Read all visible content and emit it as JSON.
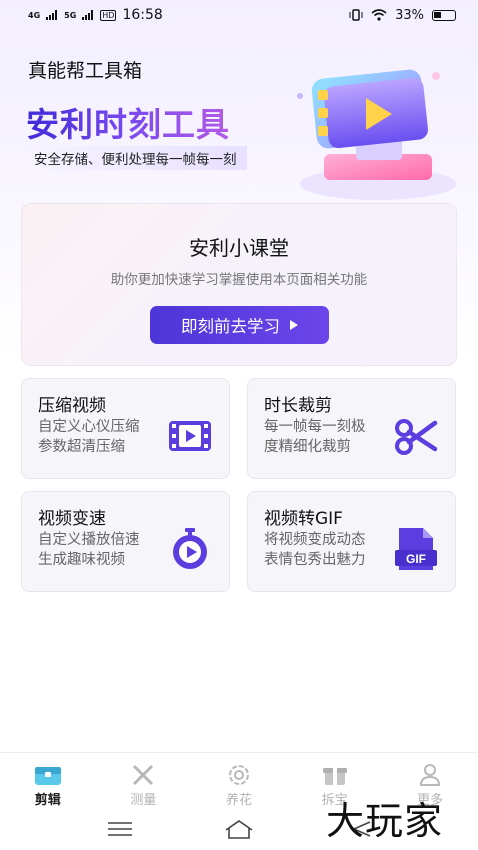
{
  "status_bar": {
    "network1": "4G",
    "network2": "5G",
    "hd": "HD",
    "time": "16:58",
    "battery": "33%"
  },
  "header": {
    "brand": "真能帮工具箱",
    "hero_title": "安利时刻工具",
    "hero_subtitle": "安全存储、便利处理每一帧每一刻"
  },
  "class_card": {
    "title": "安利小课堂",
    "description": "助你更加快速学习掌握使用本页面相关功能",
    "button_label": "即刻前去学习"
  },
  "tools": [
    {
      "title": "压缩视频",
      "description": "自定义心仪压缩 参数超清压缩",
      "icon": "film-icon"
    },
    {
      "title": "时长裁剪",
      "description": "每一帧每一刻极度精细化裁剪",
      "icon": "scissors-icon"
    },
    {
      "title": "视频变速",
      "description": "自定义播放倍速生成趣味视频",
      "icon": "stopwatch-icon"
    },
    {
      "title": "视频转GIF",
      "description": "将视频变成动态表情包秀出魅力",
      "icon": "gif-file-icon"
    }
  ],
  "tabs": [
    {
      "label": "剪辑",
      "icon": "toolbox-icon",
      "active": true
    },
    {
      "label": "测量",
      "icon": "ruler-icon",
      "active": false
    },
    {
      "label": "养花",
      "icon": "flower-icon",
      "active": false
    },
    {
      "label": "拆宝",
      "icon": "gift-box-icon",
      "active": false
    },
    {
      "label": "更多",
      "icon": "person-icon",
      "active": false
    }
  ],
  "watermark": "大玩家",
  "colors": {
    "accent": "#5b3de0",
    "card_bg": "#f5f5fa",
    "icon_purple": "#5b3de0"
  }
}
